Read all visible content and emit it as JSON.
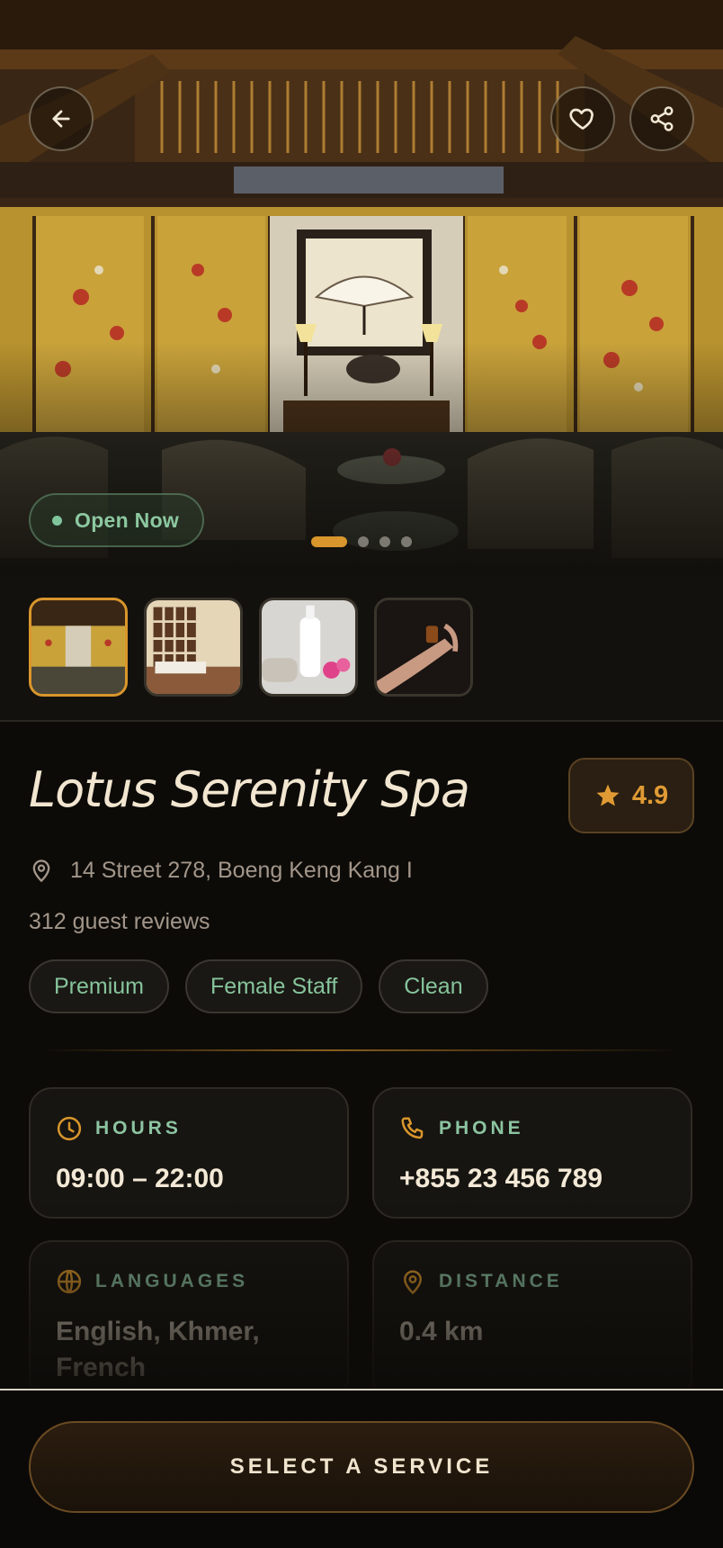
{
  "hero": {
    "status_badge": "Open Now",
    "carousel": {
      "total": 4,
      "active_index": 0
    }
  },
  "actions": {
    "back_icon": "arrow-left-icon",
    "favorite_icon": "heart-icon",
    "share_icon": "share-icon"
  },
  "gallery": {
    "thumbnails": [
      {
        "name": "lounge-interior",
        "active": true
      },
      {
        "name": "treatment-room",
        "active": false
      },
      {
        "name": "spa-products",
        "active": false
      },
      {
        "name": "massage-oil",
        "active": false
      }
    ]
  },
  "spa": {
    "name": "Lotus Serenity Spa",
    "rating": "4.9",
    "address": "14 Street 278, Boeng Keng Kang I",
    "reviews": "312 guest reviews",
    "tags": [
      "Premium",
      "Female Staff",
      "Clean"
    ]
  },
  "details": {
    "hours": {
      "label": "HOURS",
      "value": "09:00 – 22:00"
    },
    "phone": {
      "label": "PHONE",
      "value": "+855 23 456 789"
    },
    "languages": {
      "label": "LANGUAGES",
      "value": "English, Khmer, French"
    },
    "distance": {
      "label": "DISTANCE",
      "value": "0.4 km"
    }
  },
  "cta": {
    "label": "SELECT A SERVICE"
  },
  "colors": {
    "accent": "#d9962c",
    "green": "#86c49c",
    "background": "#0d0b08"
  }
}
